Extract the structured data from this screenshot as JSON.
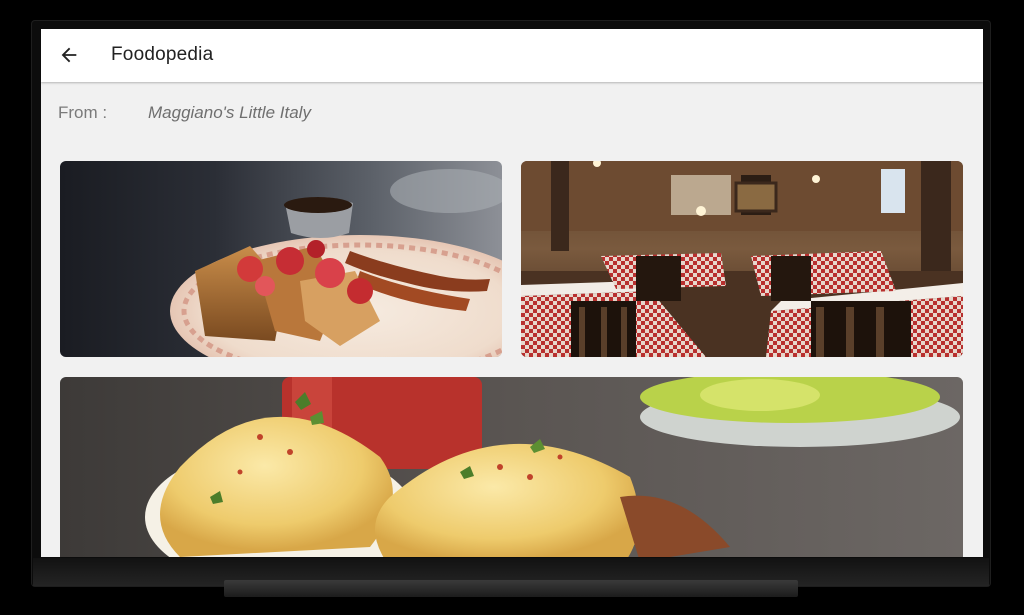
{
  "app": {
    "title": "Foodopedia",
    "back_icon": "arrow-left-icon"
  },
  "source": {
    "label": "From :",
    "restaurant": "Maggiano's Little Italy"
  },
  "photos": [
    {
      "name": "french-toast-photo"
    },
    {
      "name": "restaurant-interior-photo"
    },
    {
      "name": "eggs-benedict-photo"
    }
  ],
  "colors": {
    "app_bar": "#ffffff",
    "background": "#f1f1f1",
    "title_text": "#222222",
    "secondary_text": "#7a7a7a"
  }
}
